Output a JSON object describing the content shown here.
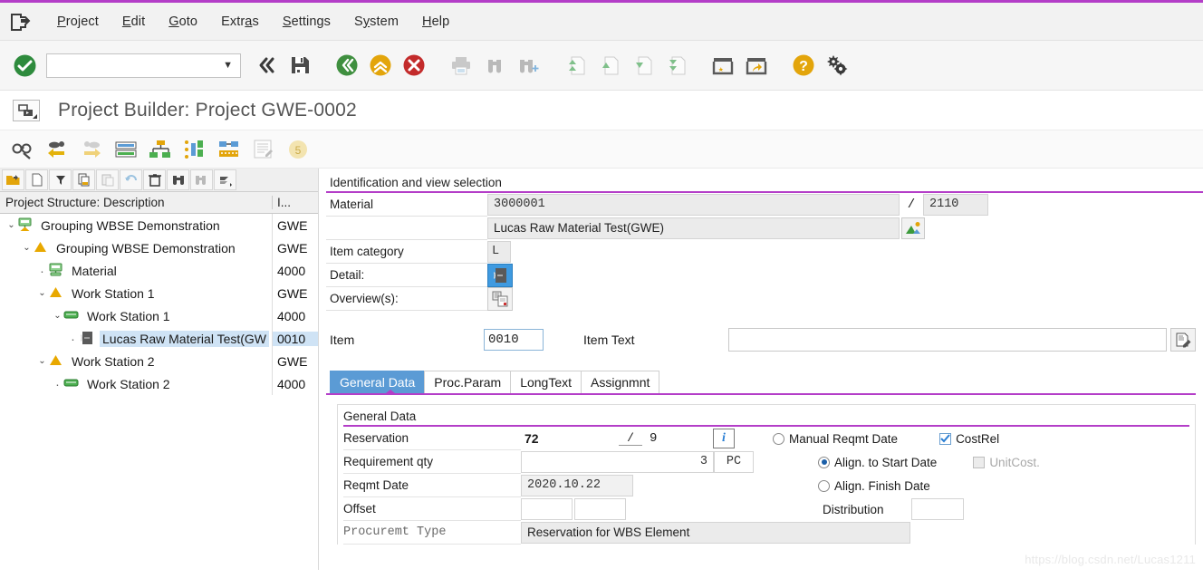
{
  "window": {
    "title": "Project Builder: Project GWE-0002"
  },
  "menubar": {
    "system_icon": "sap-system-icon",
    "items": [
      {
        "label": "Project",
        "accel": "P"
      },
      {
        "label": "Edit",
        "accel": "E"
      },
      {
        "label": "Goto",
        "accel": "G"
      },
      {
        "label": "Extras",
        "accel": "a"
      },
      {
        "label": "Settings",
        "accel": "S"
      },
      {
        "label": "System",
        "accel": "y"
      },
      {
        "label": "Help",
        "accel": "H"
      }
    ]
  },
  "toolbar": {
    "command_field_value": "",
    "command_field_placeholder": "",
    "buttons": [
      {
        "name": "enter-check-icon",
        "title": "Enter"
      },
      {
        "name": "command-field",
        "title": "Command field"
      },
      {
        "name": "back-double-chevron-icon",
        "title": "Back"
      },
      {
        "name": "save-floppy-icon",
        "title": "Save"
      },
      {
        "name": "back-green-icon",
        "title": "Back"
      },
      {
        "name": "exit-yellow-icon",
        "title": "Exit"
      },
      {
        "name": "cancel-red-icon",
        "title": "Cancel"
      },
      {
        "name": "print-icon",
        "title": "Print"
      },
      {
        "name": "find-binoculars-icon",
        "title": "Find"
      },
      {
        "name": "find-next-binoculars-icon",
        "title": "Find next"
      },
      {
        "name": "first-page-icon",
        "title": "First page"
      },
      {
        "name": "previous-page-icon",
        "title": "Previous page"
      },
      {
        "name": "next-page-icon",
        "title": "Next page"
      },
      {
        "name": "last-page-icon",
        "title": "Last page"
      },
      {
        "name": "create-session-icon",
        "title": "Create new session"
      },
      {
        "name": "create-shortcut-icon",
        "title": "Create shortcut"
      },
      {
        "name": "help-question-icon",
        "title": "Help"
      },
      {
        "name": "customize-gears-icon",
        "title": "Customize local layout"
      }
    ]
  },
  "apptoolbar": {
    "buttons": [
      {
        "name": "glasses-pencil-icon",
        "title": "Display/Change"
      },
      {
        "name": "back-arrow-icon",
        "title": "Previous"
      },
      {
        "name": "forward-arrow-icon",
        "title": "Next"
      },
      {
        "name": "list-view-icon",
        "title": "List"
      },
      {
        "name": "hierarchy-icon",
        "title": "Hierarchy graphic"
      },
      {
        "name": "bar-chart-icon",
        "title": "Gantt"
      },
      {
        "name": "network-icon",
        "title": "Network graphic"
      },
      {
        "name": "report-icon",
        "title": "Report"
      },
      {
        "name": "session-badge-icon",
        "title": "5"
      }
    ]
  },
  "tree": {
    "toolbar_buttons": [
      {
        "name": "open-folder-icon"
      },
      {
        "name": "new-document-icon"
      },
      {
        "name": "filter-icon"
      },
      {
        "name": "copy-icon"
      },
      {
        "name": "paste-icon"
      },
      {
        "name": "undo-icon"
      },
      {
        "name": "delete-trash-icon"
      },
      {
        "name": "find-binoculars-icon"
      },
      {
        "name": "find-next-icon"
      },
      {
        "name": "more-icon"
      }
    ],
    "columns": [
      "Project Structure: Description",
      "I..."
    ],
    "rows": [
      {
        "label": "Grouping WBSE Demonstration",
        "id": "GWE",
        "indent": 0,
        "twisty": "expanded",
        "icon": "project-definition-icon",
        "selected": false
      },
      {
        "label": "Grouping WBSE Demonstration",
        "id": "GWE",
        "indent": 1,
        "twisty": "expanded",
        "icon": "wbs-element-icon",
        "selected": false
      },
      {
        "label": "Material",
        "id": "4000",
        "indent": 2,
        "twisty": "leaf",
        "icon": "material-icon",
        "selected": false
      },
      {
        "label": "Work Station 1",
        "id": "GWE",
        "indent": 2,
        "twisty": "expanded",
        "icon": "wbs-element-icon",
        "selected": false
      },
      {
        "label": "Work Station 1",
        "id": "4000",
        "indent": 3,
        "twisty": "expanded",
        "icon": "activity-icon",
        "selected": false
      },
      {
        "label": "Lucas Raw Material Test(GW",
        "id": "0010",
        "indent": 4,
        "twisty": "leaf",
        "icon": "component-icon",
        "selected": true
      },
      {
        "label": "Work Station 2",
        "id": "GWE",
        "indent": 2,
        "twisty": "expanded",
        "icon": "wbs-element-icon",
        "selected": false
      },
      {
        "label": "Work Station 2",
        "id": "4000",
        "indent": 3,
        "twisty": "leaf",
        "icon": "activity-icon",
        "selected": false
      }
    ]
  },
  "identification": {
    "section_title": "Identification and view selection",
    "material_label": "Material",
    "material_value": "3000001",
    "material_sep": "/",
    "plant_value": "2110",
    "description_value": "Lucas Raw Material Test(GWE)",
    "description_icon": "material-picture-icon",
    "item_category_label": "Item category",
    "item_category_value": "L",
    "detail_label": "Detail:",
    "detail_icon": "detail-screen-icon",
    "overviews_label": "Overview(s):",
    "overviews_icon": "overview-screen-icon"
  },
  "item": {
    "item_label": "Item",
    "item_value": "0010",
    "item_text_label": "Item Text",
    "item_text_value": "",
    "long_text_icon": "long-text-editor-icon"
  },
  "tabs": [
    {
      "label": "General Data",
      "active": true
    },
    {
      "label": "Proc.Param",
      "active": false
    },
    {
      "label": "LongText",
      "active": false
    },
    {
      "label": "Assignmnt",
      "active": false
    }
  ],
  "general_data": {
    "title": "General Data",
    "reservation_label": "Reservation",
    "reservation_value": "72",
    "reservation_sep": "/",
    "reservation_item": "9",
    "reservation_info_icon": "info-icon",
    "requirement_qty_label": "Requirement qty",
    "requirement_qty_value": "3",
    "requirement_qty_uom": "PC",
    "reqmt_date_label": "Reqmt Date",
    "reqmt_date_value": "2020.10.22",
    "offset_label": "Offset",
    "offset_value_1": "",
    "offset_value_2": "",
    "procuremt_type_label": "Procuremt Type",
    "procuremt_type_value": "Reservation for WBS Element",
    "date_options": [
      {
        "label": "Manual Reqmt Date",
        "selected": false
      },
      {
        "label": "Align. to Start Date",
        "selected": true
      },
      {
        "label": "Align. Finish Date",
        "selected": false
      }
    ],
    "distribution_label": "Distribution",
    "distribution_value": "",
    "checkboxes": [
      {
        "label": "CostRel",
        "checked": true,
        "disabled": false
      },
      {
        "label": "UnitCost.",
        "checked": false,
        "disabled": true
      }
    ]
  },
  "watermark": {
    "text": "https://blog.csdn.net/Lucas1211"
  },
  "colors": {
    "accent_purple": "#b43ec8",
    "tab_active_blue": "#5b9bd5",
    "selection_blue": "#cfe3f5",
    "wbs_yellow": "#f0ab00",
    "green": "#4caf50"
  }
}
